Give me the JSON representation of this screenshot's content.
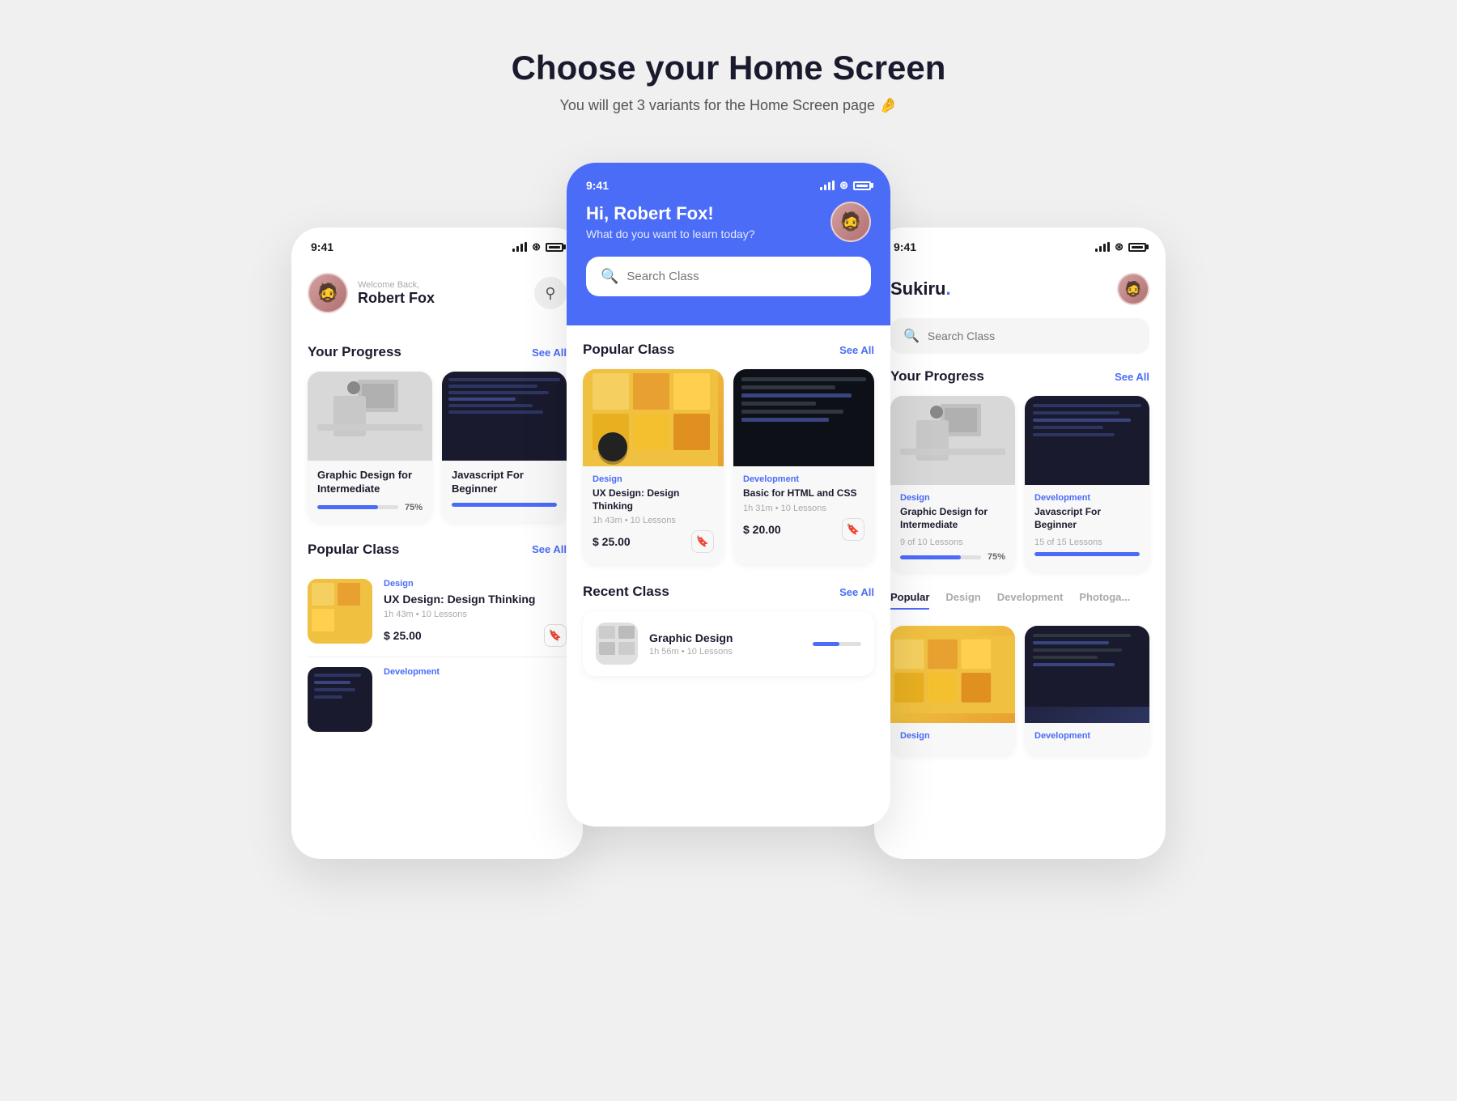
{
  "header": {
    "title": "Choose your Home Screen",
    "subtitle": "You will get 3 variants for the Home Screen page 🤌"
  },
  "left_phone": {
    "status_time": "9:41",
    "user": {
      "welcome": "Welcome Back,",
      "name": "Robert Fox"
    },
    "progress_section": {
      "title": "Your Progress",
      "see_all": "See All",
      "cards": [
        {
          "title": "Graphic Design for Intermediate",
          "progress": 75,
          "progress_label": "75%",
          "type": "design"
        },
        {
          "title": "Javascript For Beginner",
          "progress": 100,
          "progress_label": "",
          "type": "js"
        }
      ]
    },
    "popular_section": {
      "title": "Popular Class",
      "see_all": "See All",
      "items": [
        {
          "badge": "Design",
          "title": "UX Design: Design Thinking",
          "meta": "1h 43m  •  10 Lessons",
          "price": "$ 25.00",
          "type": "stickies"
        },
        {
          "badge": "Development",
          "title": "",
          "meta": "",
          "price": "",
          "type": "code"
        }
      ]
    }
  },
  "center_phone": {
    "status_time": "9:41",
    "greeting": {
      "hi": "Hi, ",
      "name": "Robert Fox!",
      "subtitle": "What do you want to learn today?"
    },
    "search_placeholder": "Search Class",
    "popular_section": {
      "title": "Popular Class",
      "see_all": "See All",
      "cards": [
        {
          "badge": "Design",
          "title": "UX Design: Design Thinking",
          "meta": "1h 43m  •  10 Lessons",
          "price": "$ 25.00",
          "type": "stickies"
        },
        {
          "badge": "Development",
          "title": "Basic for HTML and CSS",
          "meta": "1h 31m  •  10 Lessons",
          "price": "$ 20.00",
          "type": "code"
        }
      ]
    },
    "recent_section": {
      "title": "Recent Class",
      "see_all": "See All",
      "items": [
        {
          "title": "Graphic Design",
          "meta": "1h 56m  •  10 Lessons",
          "progress": 55
        }
      ]
    }
  },
  "right_phone": {
    "status_time": "9:41",
    "brand": "Sukiru",
    "brand_dot": ".",
    "search_placeholder": "Search Class",
    "progress_section": {
      "title": "Your Progress",
      "see_all": "See All",
      "cards": [
        {
          "badge": "Design",
          "title": "Graphic Design for Intermediate",
          "lessons": "9 of 10 Lessons",
          "progress": 75,
          "progress_label": "75%",
          "type": "design"
        },
        {
          "badge": "Development",
          "title": "Javascript For Beginner",
          "lessons": "15 of 15 Lessons",
          "progress": 100,
          "progress_label": "",
          "type": "js"
        }
      ]
    },
    "popular_section": {
      "title": "Popular",
      "tabs": [
        "Popular",
        "Design",
        "Development",
        "Photoga..."
      ],
      "cards": [
        {
          "type": "stickies",
          "badge": "Design"
        },
        {
          "type": "code",
          "badge": "Development"
        }
      ]
    }
  }
}
